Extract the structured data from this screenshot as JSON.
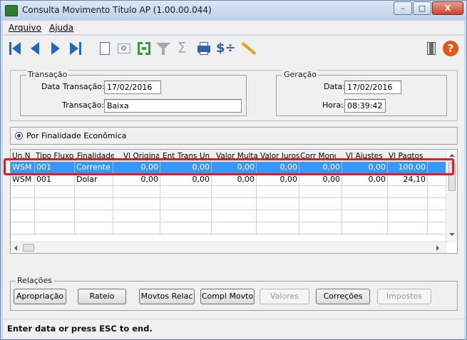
{
  "window": {
    "title": "Consulta Movimento Título AP (1.00.00.044)",
    "controls": {
      "minimize": "–",
      "maximize": "□",
      "close": "X"
    }
  },
  "menu": {
    "items": [
      "Arquivo",
      "Ajuda"
    ]
  },
  "toolbar": {
    "icons": [
      "first-icon",
      "prev-icon",
      "next-icon",
      "last-icon",
      "new-document-icon",
      "zoom-icon",
      "bracket-icon",
      "filter-icon",
      "sum-icon",
      "print-icon",
      "dollar-icon",
      "pencil-icon",
      "exit-door-icon",
      "help-icon"
    ],
    "help_label": "?",
    "dollar_label": "$÷",
    "sum_label": "Σ"
  },
  "transacao": {
    "legend": "Transação",
    "data_label": "Data Transação:",
    "data_value": "17/02/2016",
    "transacao_label": "Transação:",
    "transacao_value": "Baixa"
  },
  "geracao": {
    "legend": "Geração",
    "data_label": "Data:",
    "data_value": "17/02/2016",
    "hora_label": "Hora:",
    "hora_value": "08:39:42"
  },
  "finalidade": {
    "label": "Por Finalidade Econômica"
  },
  "grid": {
    "columns": [
      "Un.N",
      "Tipo Fluxo",
      "Finalidade",
      "Vl Original",
      "Ent Trans Un",
      "Valor Multa",
      "Valor Juros",
      "Corr Monet",
      "Vl Ajustes",
      "Vl Pagtos"
    ],
    "rows": [
      [
        "WSM",
        "001",
        "Corrente",
        "0,00",
        "0,00",
        "0,00",
        "0,00",
        "0,00",
        "0,00",
        "100,00"
      ],
      [
        "WSM",
        "001",
        "Dolar",
        "0,00",
        "0,00",
        "0,00",
        "0,00",
        "0,00",
        "0,00",
        "24,10"
      ]
    ]
  },
  "relacoes": {
    "legend": "Relações",
    "buttons": [
      "Apropriação",
      "Rateio",
      "Movtos Relac",
      "Compl Movto",
      "Valores",
      "Correções",
      "Impostos"
    ]
  },
  "status": {
    "text": "Enter data or press ESC to end."
  }
}
